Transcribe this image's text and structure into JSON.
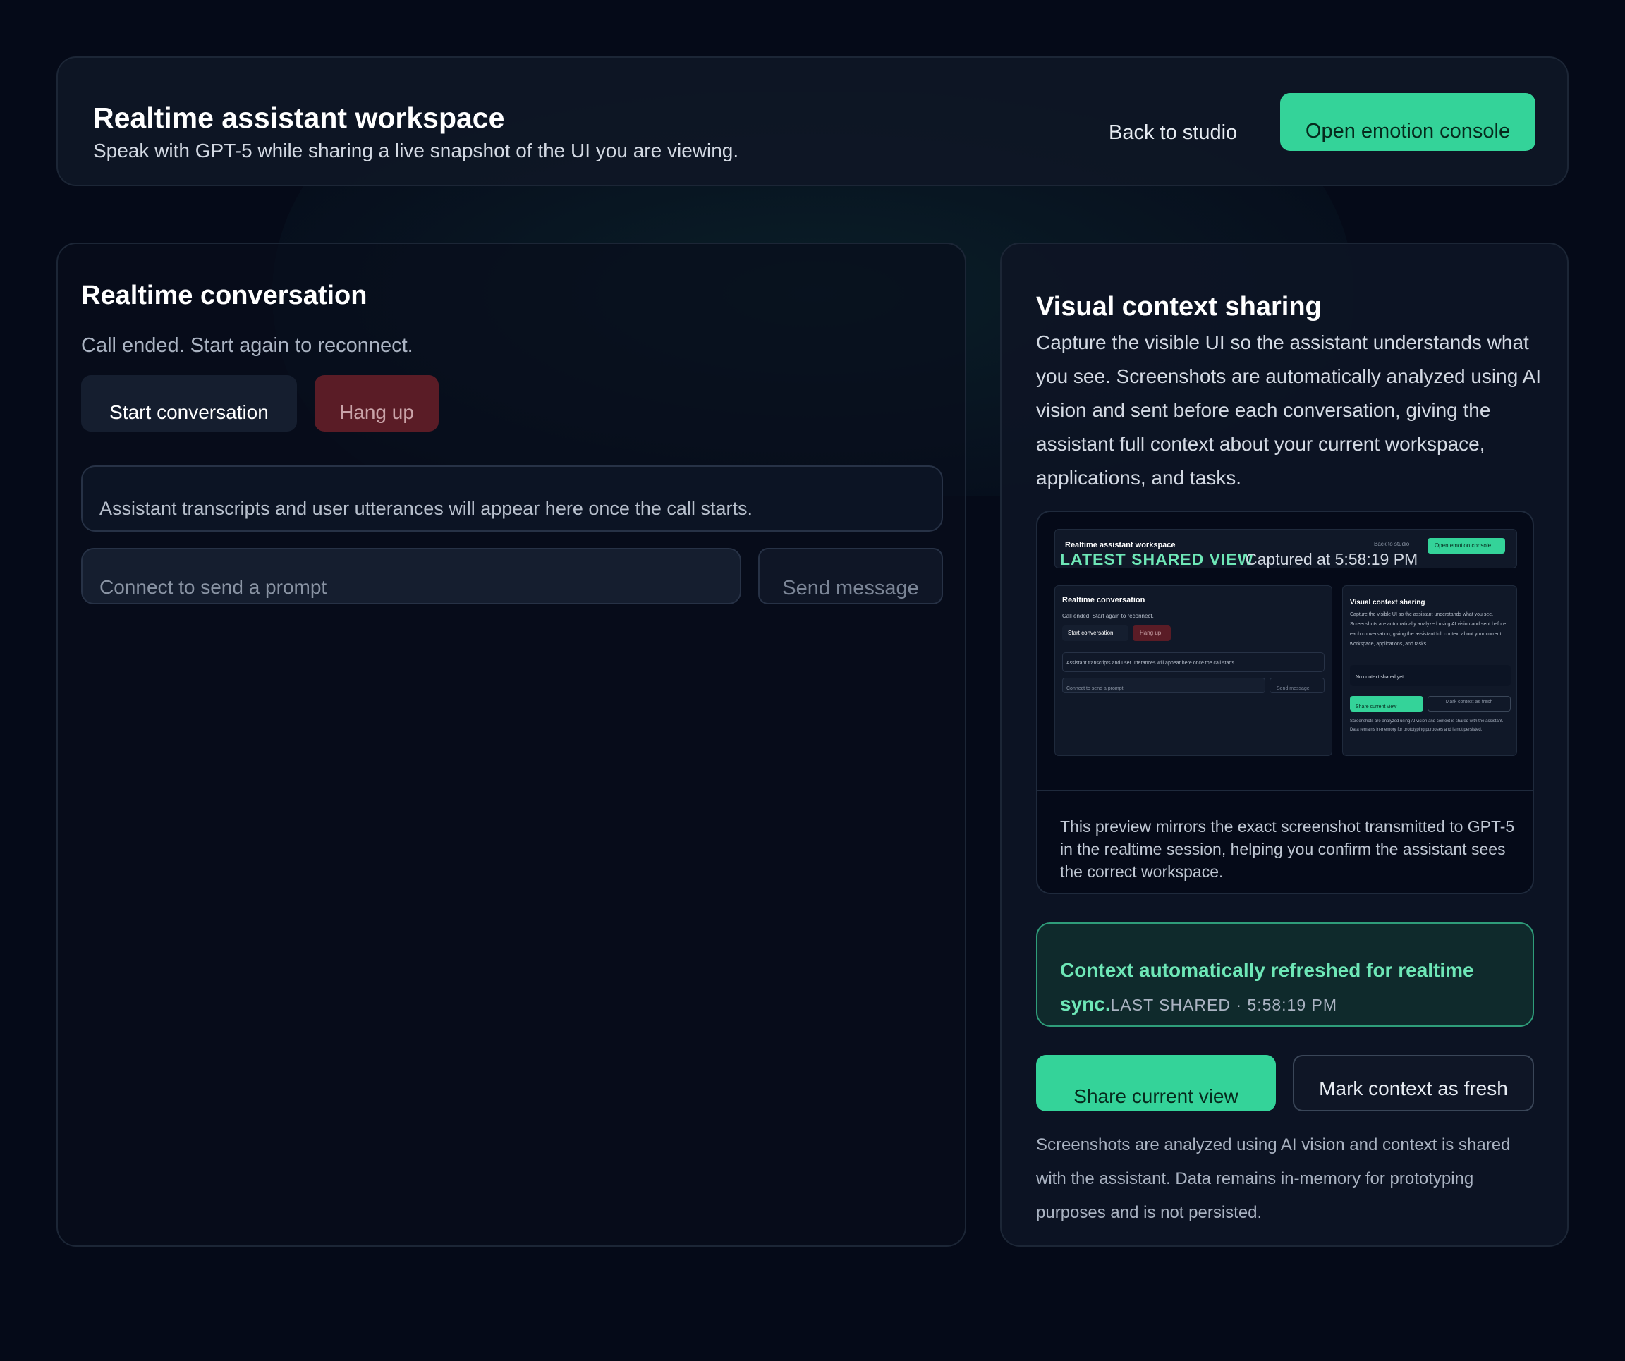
{
  "header": {
    "title": "Realtime assistant workspace",
    "subtitle": "Speak with GPT-5 while sharing a live snapshot of the UI you are viewing.",
    "back_label": "Back to studio",
    "emotion_label": "Open emotion console"
  },
  "conversation": {
    "title": "Realtime conversation",
    "status": "Call ended. Start again to reconnect.",
    "start_label": "Start conversation",
    "hangup_label": "Hang up",
    "transcript_placeholder": "Assistant transcripts and user utterances will appear here once the call starts.",
    "prompt_placeholder": "Connect to send a prompt",
    "send_label": "Send message"
  },
  "visual": {
    "title": "Visual context sharing",
    "description": "Capture the visible UI so the assistant understands what you see. Screenshots are automatically analyzed using AI vision and sent before each conversation, giving the assistant full context about your current workspace, applications, and tasks.",
    "preview_label": "LATEST SHARED VIEW",
    "captured": "Captured at 5:58:19 PM",
    "preview_caption": "This preview mirrors the exact screenshot transmitted to GPT-5 in the realtime session, helping you confirm the assistant sees the correct workspace.",
    "status_message": "Context automatically refreshed for realtime sync.",
    "status_time": "LAST SHARED · 5:58:19 PM",
    "share_label": "Share current view",
    "fresh_label": "Mark context as fresh",
    "footnote": "Screenshots are analyzed using AI vision and context is shared with the assistant. Data remains in-memory for prototyping purposes and is not persisted."
  },
  "mini_preview": {
    "title": "Realtime assistant workspace",
    "back": "Back to studio",
    "emotion": "Open emotion console",
    "conv_title": "Realtime conversation",
    "conv_status": "Call ended. Start again to reconnect.",
    "start": "Start conversation",
    "hangup": "Hang up",
    "transcript": "Assistant transcripts and user utterances will appear here once the call starts.",
    "prompt": "Connect to send a prompt",
    "send": "Send message",
    "vis_title": "Visual context sharing",
    "vis_desc": "Capture the visible UI so the assistant understands what you see. Screenshots are automatically analyzed using AI vision and sent before each conversation, giving the assistant full context about your current workspace, applications, and tasks.",
    "no_context": "No context shared yet.",
    "share": "Share current view",
    "fresh": "Mark context as fresh",
    "footnote": "Screenshots are analyzed using AI vision and context is shared with the assistant. Data remains in-memory for prototyping purposes and is not persisted."
  },
  "colors": {
    "background": "#050a18",
    "accent": "#34d399",
    "accent_text": "#6ee7b7",
    "danger": "#5a1c26"
  }
}
